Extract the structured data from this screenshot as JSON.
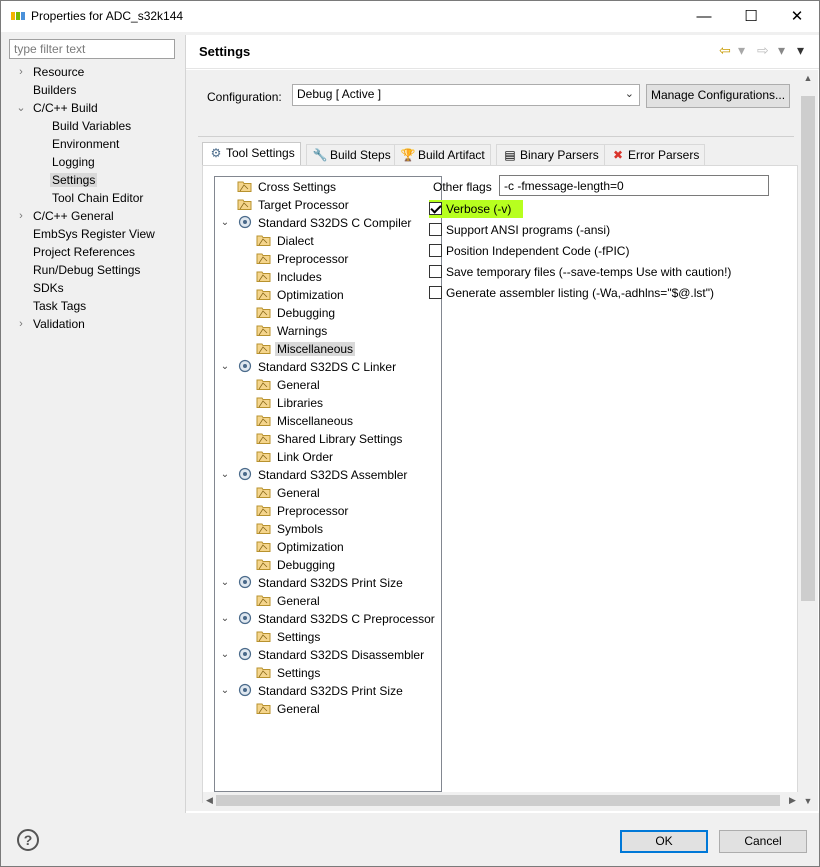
{
  "window": {
    "title": "Properties for ADC_s32k144",
    "app_icon": "nxp-logo-icon",
    "controls": {
      "minimize": "—",
      "maximize": "☐",
      "close": "✕"
    }
  },
  "filter": {
    "placeholder": "type filter text",
    "value": ""
  },
  "nav": {
    "items": [
      {
        "label": "Resource",
        "expander": "›"
      },
      {
        "label": "Builders",
        "expander": ""
      },
      {
        "label": "C/C++ Build",
        "expander": "⌄"
      },
      {
        "label": "Build Variables",
        "expander": ""
      },
      {
        "label": "Environment",
        "expander": ""
      },
      {
        "label": "Logging",
        "expander": ""
      },
      {
        "label": "Settings",
        "expander": ""
      },
      {
        "label": "Tool Chain Editor",
        "expander": ""
      },
      {
        "label": "C/C++ General",
        "expander": "›"
      },
      {
        "label": "EmbSys Register View",
        "expander": ""
      },
      {
        "label": "Project References",
        "expander": ""
      },
      {
        "label": "Run/Debug Settings",
        "expander": ""
      },
      {
        "label": "SDKs",
        "expander": ""
      },
      {
        "label": "Task Tags",
        "expander": ""
      },
      {
        "label": "Validation",
        "expander": "›"
      }
    ],
    "selected": "Settings"
  },
  "settings": {
    "title": "Settings",
    "back_icon": "⇦",
    "forward_icon": "⇨",
    "menu_icon": "▾",
    "config_label": "Configuration:",
    "config_value": "Debug  [ Active ]",
    "manage_button": "Manage Configurations..."
  },
  "tabs": [
    {
      "label": "Tool Settings",
      "icon": "tool-settings-icon",
      "glyph": "⚙"
    },
    {
      "label": "Build Steps",
      "icon": "build-steps-icon",
      "glyph": "🔧"
    },
    {
      "label": "Build Artifact",
      "icon": "build-artifact-icon",
      "glyph": "🏆"
    },
    {
      "label": "Binary Parsers",
      "icon": "binary-parsers-icon",
      "glyph": "▤"
    },
    {
      "label": "Error Parsers",
      "icon": "error-parsers-icon",
      "glyph": "✖"
    }
  ],
  "tool_tree": [
    {
      "label": "Cross Settings"
    },
    {
      "label": "Target Processor"
    },
    {
      "label": "Standard S32DS C Compiler"
    },
    {
      "label": "Dialect"
    },
    {
      "label": "Preprocessor"
    },
    {
      "label": "Includes"
    },
    {
      "label": "Optimization"
    },
    {
      "label": "Debugging"
    },
    {
      "label": "Warnings"
    },
    {
      "label": "Miscellaneous"
    },
    {
      "label": "Standard S32DS C Linker"
    },
    {
      "label": "General"
    },
    {
      "label": "Libraries"
    },
    {
      "label": "Miscellaneous"
    },
    {
      "label": "Shared Library Settings"
    },
    {
      "label": "Link Order"
    },
    {
      "label": "Standard S32DS Assembler"
    },
    {
      "label": "General"
    },
    {
      "label": "Preprocessor"
    },
    {
      "label": "Symbols"
    },
    {
      "label": "Optimization"
    },
    {
      "label": "Debugging"
    },
    {
      "label": "Standard S32DS Print Size"
    },
    {
      "label": "General"
    },
    {
      "label": "Standard S32DS C Preprocessor"
    },
    {
      "label": "Settings"
    },
    {
      "label": "Standard S32DS Disassembler"
    },
    {
      "label": "Settings"
    },
    {
      "label": "Standard S32DS Print Size"
    },
    {
      "label": "General"
    }
  ],
  "tool_tree_selected": "Miscellaneous",
  "options": {
    "other_flags_label": "Other flags",
    "other_flags_value": "-c -fmessage-length=0",
    "checkboxes": [
      {
        "label": "Verbose (-v)",
        "checked": true
      },
      {
        "label": "Support ANSI programs (-ansi)",
        "checked": false
      },
      {
        "label": "Position Independent Code (-fPIC)",
        "checked": false
      },
      {
        "label": "Save temporary files (--save-temps Use with caution!)",
        "checked": false
      },
      {
        "label": "Generate assembler listing (-Wa,-adhlns=\"$@.lst\")",
        "checked": false
      }
    ],
    "highlight_color": "#b7ff1f"
  },
  "footer": {
    "help": "?",
    "ok": "OK",
    "cancel": "Cancel"
  }
}
